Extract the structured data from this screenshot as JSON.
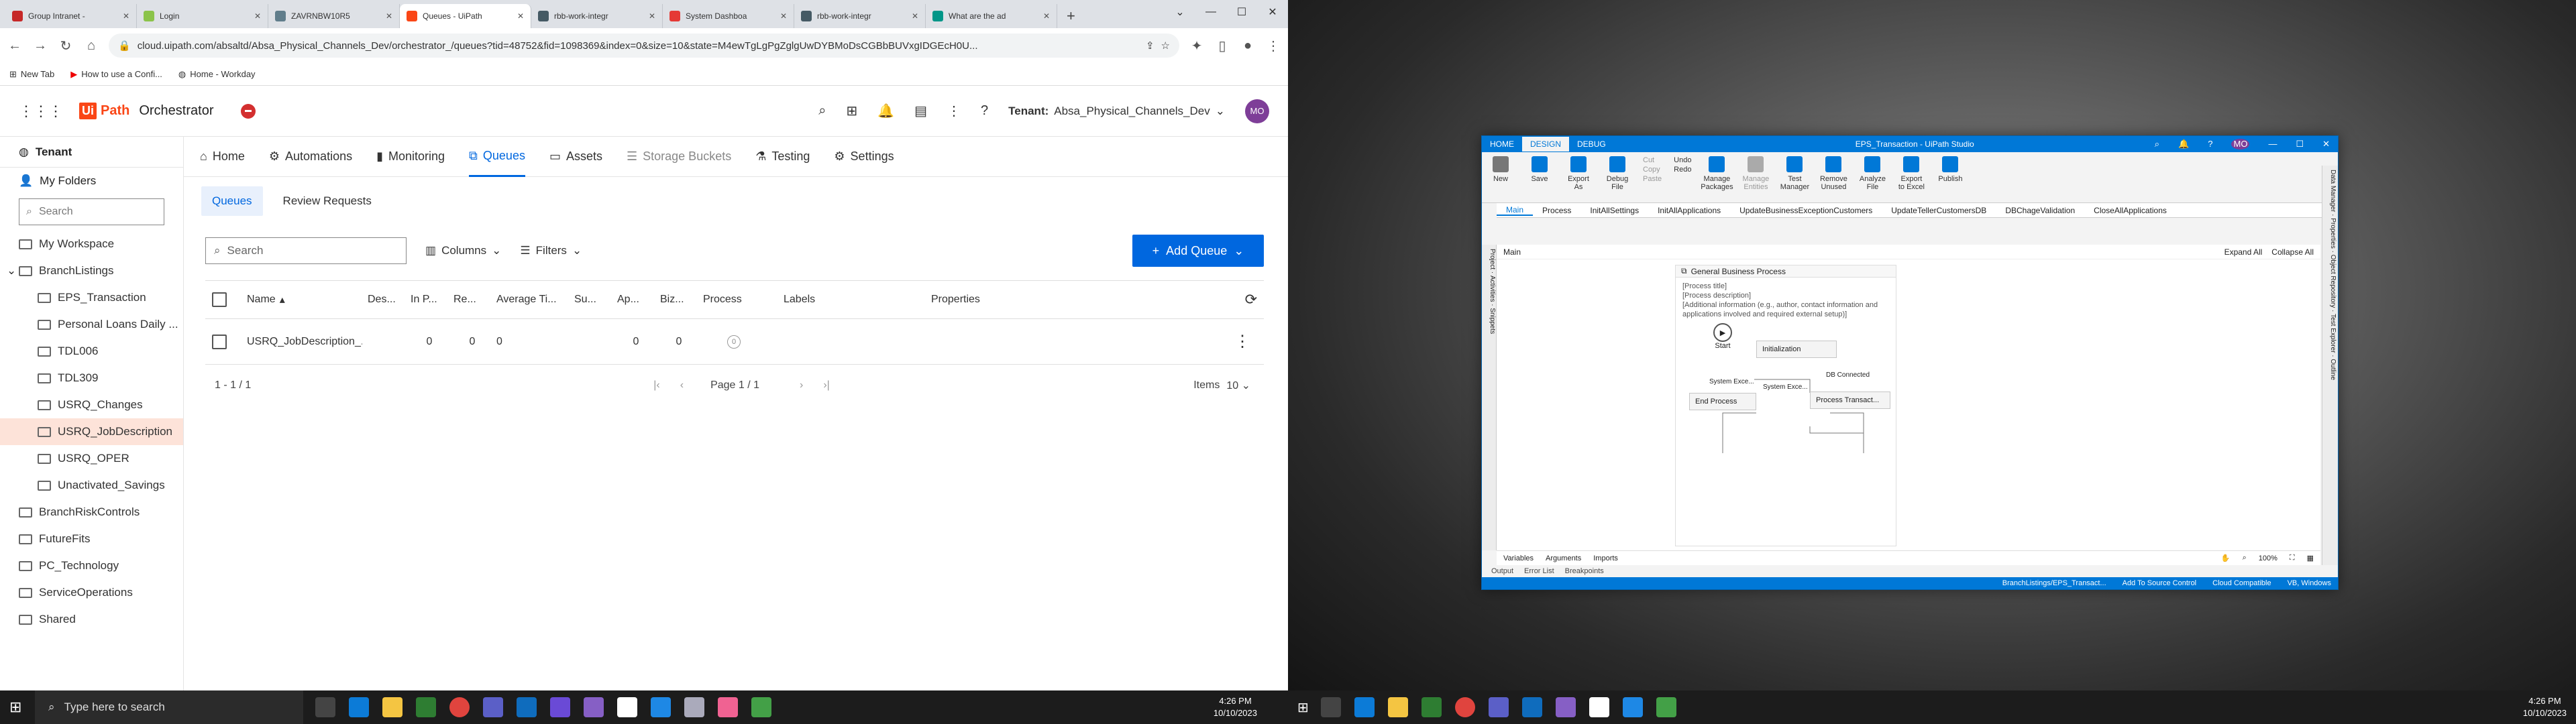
{
  "browser": {
    "tabs": [
      {
        "label": "Group Intranet -",
        "color": "#c62828"
      },
      {
        "label": "Login",
        "color": "#8bc34a"
      },
      {
        "label": "ZAVRNBW10R5",
        "color": "#607d8b"
      },
      {
        "label": "Queues - UiPath",
        "color": "#fa4616",
        "active": true
      },
      {
        "label": "rbb-work-integr",
        "color": "#455a64"
      },
      {
        "label": "System Dashboa",
        "color": "#e53935"
      },
      {
        "label": "rbb-work-integr",
        "color": "#455a64"
      },
      {
        "label": "What are the ad",
        "color": "#009688"
      }
    ],
    "window_controls": [
      "⌄",
      "—",
      "☐",
      "✕"
    ],
    "url": "cloud.uipath.com/absaltd/Absa_Physical_Channels_Dev/orchestrator_/queues?tid=48752&fid=1098369&index=0&size=10&state=M4ewTgLgPgZglgUwDYBMoDsCGBbBUVxgIDGEcH0U...",
    "bookmarks": [
      "New Tab",
      "How to use a Confi...",
      "Home - Workday"
    ]
  },
  "orchestrator": {
    "product": "Orchestrator",
    "logo_ui": "Ui",
    "logo_path": "Path",
    "tenant_label": "Tenant:",
    "tenant_value": "Absa_Physical_Channels_Dev",
    "avatar": "MO",
    "nav": [
      "Home",
      "Automations",
      "Monitoring",
      "Queues",
      "Assets",
      "Storage Buckets",
      "Testing",
      "Settings"
    ],
    "subtabs": [
      "Queues",
      "Review Requests"
    ],
    "search_placeholder": "Search",
    "columns_btn": "Columns",
    "filters_btn": "Filters",
    "add_queue": "Add Queue",
    "table_headers": [
      "Name",
      "Des...",
      "In P...",
      "Re...",
      "Average Ti...",
      "Su...",
      "Ap...",
      "Biz...",
      "Process",
      "Labels",
      "Properties"
    ],
    "row": [
      "USRQ_JobDescription_...",
      "",
      "0",
      "0",
      "0",
      "",
      "0",
      "0",
      "0",
      "",
      "",
      ""
    ],
    "footer_count": "1 - 1 / 1",
    "page": "Page 1 / 1",
    "items_label": "Items",
    "items_value": "10"
  },
  "sidebar": {
    "tenant": "Tenant",
    "my_folders": "My Folders",
    "search": "Search",
    "tree": [
      {
        "label": "My Workspace",
        "indent": 0
      },
      {
        "label": "BranchListings",
        "indent": 0,
        "expanded": true
      },
      {
        "label": "EPS_Transaction",
        "indent": 1
      },
      {
        "label": "Personal Loans Daily ...",
        "indent": 1
      },
      {
        "label": "TDL006",
        "indent": 1
      },
      {
        "label": "TDL309",
        "indent": 1
      },
      {
        "label": "USRQ_Changes",
        "indent": 1
      },
      {
        "label": "USRQ_JobDescription",
        "indent": 1,
        "selected": true
      },
      {
        "label": "USRQ_OPER",
        "indent": 1
      },
      {
        "label": "Unactivated_Savings",
        "indent": 1
      },
      {
        "label": "BranchRiskControls",
        "indent": 0
      },
      {
        "label": "FutureFits",
        "indent": 0
      },
      {
        "label": "PC_Technology",
        "indent": 0
      },
      {
        "label": "ServiceOperations",
        "indent": 0
      },
      {
        "label": "Shared",
        "indent": 0
      }
    ]
  },
  "taskbar": {
    "search": "Type here to search",
    "time": "4:26 PM",
    "date": "10/10/2023"
  },
  "studio": {
    "title": "EPS_Transaction - UiPath Studio",
    "avatar": "MO",
    "tabs": [
      "HOME",
      "DESIGN",
      "DEBUG"
    ],
    "ribbon": [
      "New",
      "Save",
      "Export As",
      "Debug File",
      "Manage Packages",
      "Manage Entities",
      "Test Manager",
      "Remove Unused",
      "Analyze File",
      "Export to Excel",
      "Publish"
    ],
    "ribbon_small": [
      "Cut",
      "Copy",
      "Paste",
      "Undo",
      "Redo"
    ],
    "file_tabs": [
      "Main",
      "Process",
      "InitAllSettings",
      "InitAllApplications",
      "UpdateBusinessExceptionCustomers",
      "UpdateTellerCustomersDB",
      "DBChageValidation",
      "CloseAllApplications"
    ],
    "breadcrumb": "Main",
    "expand_all": "Expand All",
    "collapse_all": "Collapse All",
    "gbp_title": "General Business Process",
    "annotation": [
      "[Process title]",
      "[Process description]",
      "[Additional information (e.g., author, contact information and applications involved and required external setup)]"
    ],
    "start": "Start",
    "initialization": "Initialization",
    "end_process": "End Process",
    "process_transaction": "Process Transact...",
    "edge1": "System Exce...",
    "edge2": "System Exce...",
    "edge3": "DB Connected",
    "bottom_tabs": [
      "Variables",
      "Arguments",
      "Imports"
    ],
    "zoom": "100%",
    "output_tabs": [
      "Output",
      "Error List",
      "Breakpoints"
    ],
    "status": [
      "BranchListings/EPS_Transact...",
      "Add To Source Control",
      "Cloud Compatible",
      "VB, Windows"
    ],
    "left_panel": [
      "Project",
      "Activities",
      "Snippets"
    ],
    "right_panel": [
      "Data Manager",
      "Properties",
      "Object Repository",
      "Test Explorer",
      "Outline"
    ]
  },
  "taskbar2": {
    "time": "4:26 PM",
    "date": "10/10/2023"
  }
}
